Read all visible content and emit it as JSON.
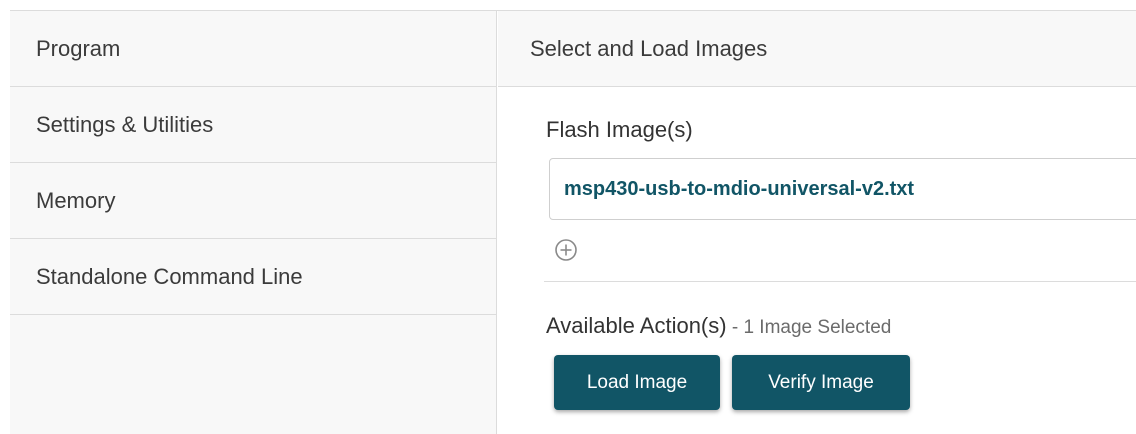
{
  "sidebar": {
    "items": [
      {
        "label": "Program"
      },
      {
        "label": "Settings & Utilities"
      },
      {
        "label": "Memory"
      },
      {
        "label": "Standalone Command Line"
      }
    ]
  },
  "main": {
    "header": "Select and Load Images",
    "flash_label": "Flash Image(s)",
    "selected_image": "msp430-usb-to-mdio-universal-v2.txt",
    "add_icon": "plus-circle-icon",
    "actions_label": "Available Action(s)",
    "actions_sub": " - 1 Image Selected",
    "buttons": {
      "load": "Load Image",
      "verify": "Verify Image"
    }
  },
  "colors": {
    "accent": "#115566",
    "sidebar_bg": "#f8f8f8",
    "border": "#dcdcdc"
  }
}
